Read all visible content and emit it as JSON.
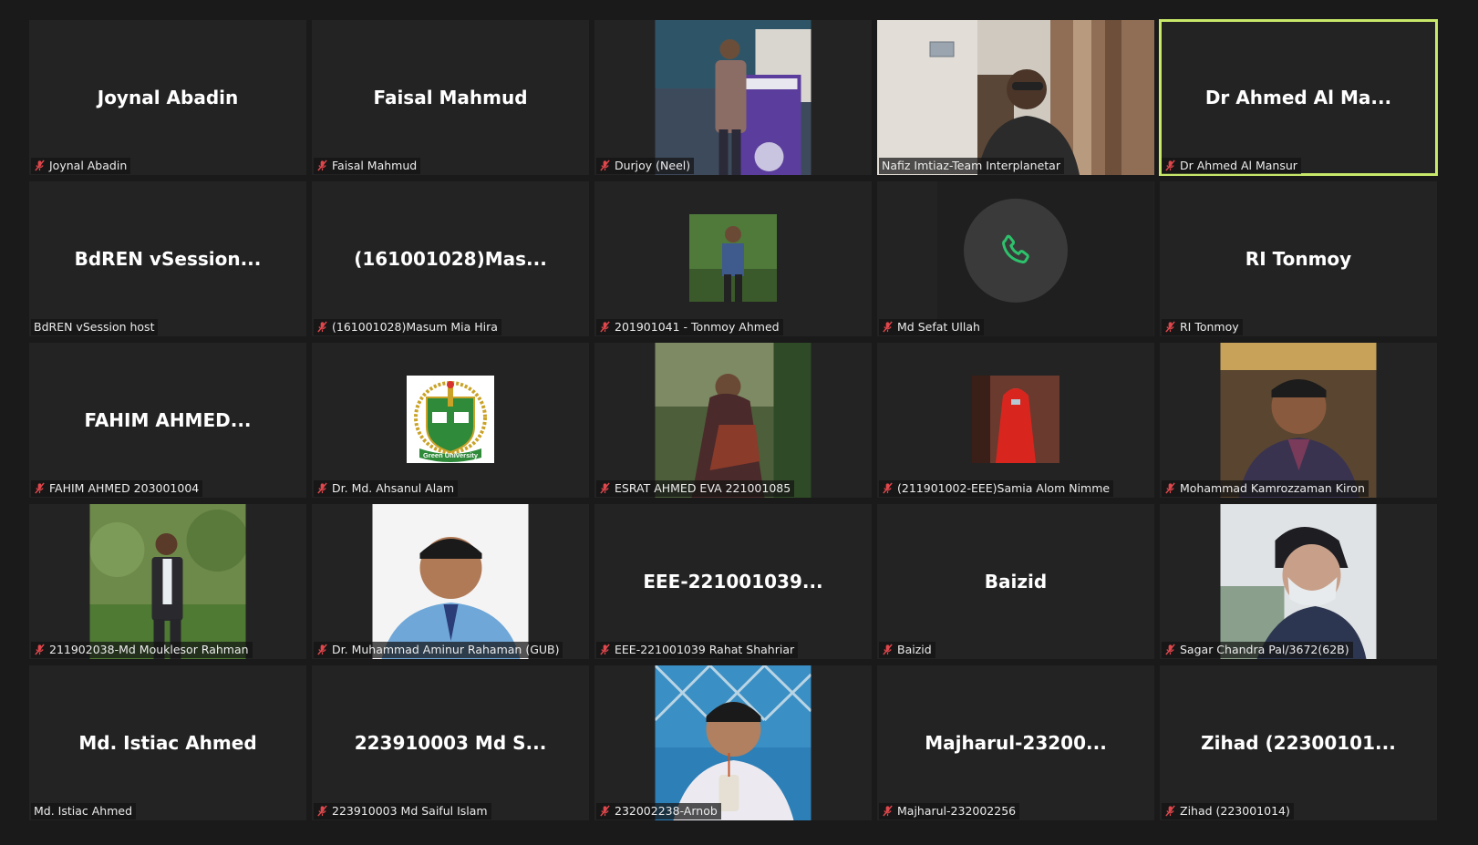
{
  "colors": {
    "active_speaker_border": "#c8e86a",
    "mute_icon": "#e0474c",
    "phone_icon": "#2dc26b"
  },
  "participants": [
    {
      "display": "Joynal Abadin",
      "label": "Joynal Abadin",
      "muted": true
    },
    {
      "display": "Faisal Mahmud",
      "label": "Faisal Mahmud",
      "muted": true
    },
    {
      "display": "",
      "label": "Durjoy (Neel)",
      "muted": true,
      "picture": "speaker-at-podium-photo"
    },
    {
      "display": "",
      "label": "Nafiz Imtiaz-Team Interplanetar",
      "muted": false,
      "picture": "live-webcam-video"
    },
    {
      "display": "Dr Ahmed Al Ma...",
      "label": "Dr Ahmed Al Mansur",
      "muted": true,
      "active": true
    },
    {
      "display": "BdREN  vSession...",
      "label": "BdREN vSession host",
      "muted": false
    },
    {
      "display": "(161001028)Mas...",
      "label": "(161001028)Masum Mia Hira",
      "muted": true
    },
    {
      "display": "",
      "label": "201901041 - Tonmoy Ahmed",
      "muted": true,
      "picture": "small-profile-photo"
    },
    {
      "display": "",
      "label": "Md Sefat Ullah",
      "muted": true,
      "picture": "phone-call"
    },
    {
      "display": "RI Tonmoy",
      "label": "RI Tonmoy",
      "muted": true
    },
    {
      "display": "FAHIM  AHMED...",
      "label": "FAHIM AHMED 203001004",
      "muted": true
    },
    {
      "display": "",
      "label": "Dr. Md. Ahsanul Alam",
      "muted": true,
      "picture": "green-university-logo",
      "logo_text": "Green University"
    },
    {
      "display": "",
      "label": "ESRAT AHMED EVA 221001085",
      "muted": true,
      "picture": "profile-photo"
    },
    {
      "display": "",
      "label": "(211901002-EEE)Samia Alom Nimme",
      "muted": true,
      "picture": "small-profile-photo-red"
    },
    {
      "display": "",
      "label": "Mohammad Kamrozzaman Kiron",
      "muted": true,
      "picture": "profile-photo"
    },
    {
      "display": "",
      "label": "211902038-Md Mouklesor Rahman",
      "muted": true,
      "picture": "profile-photo"
    },
    {
      "display": "",
      "label": "Dr. Muhammad Aminur Rahaman (GUB)",
      "muted": true,
      "picture": "profile-photo-light"
    },
    {
      "display": "EEE-221001039...",
      "label": "EEE-221001039 Rahat Shahriar",
      "muted": true
    },
    {
      "display": "Baizid",
      "label": "Baizid",
      "muted": true
    },
    {
      "display": "",
      "label": "Sagar Chandra Pal/3672(62B)",
      "muted": true,
      "picture": "profile-photo-light"
    },
    {
      "display": "Md. Istiac Ahmed",
      "label": "Md. Istiac Ahmed",
      "muted": false
    },
    {
      "display": "223910003 Md S...",
      "label": "223910003 Md Saiful Islam",
      "muted": true
    },
    {
      "display": "",
      "label": "232002238-Arnob",
      "muted": true,
      "picture": "profile-photo"
    },
    {
      "display": "Majharul-23200...",
      "label": "Majharul-232002256",
      "muted": true
    },
    {
      "display": "Zihad  (22300101...",
      "label": "Zihad (223001014)",
      "muted": true
    }
  ]
}
